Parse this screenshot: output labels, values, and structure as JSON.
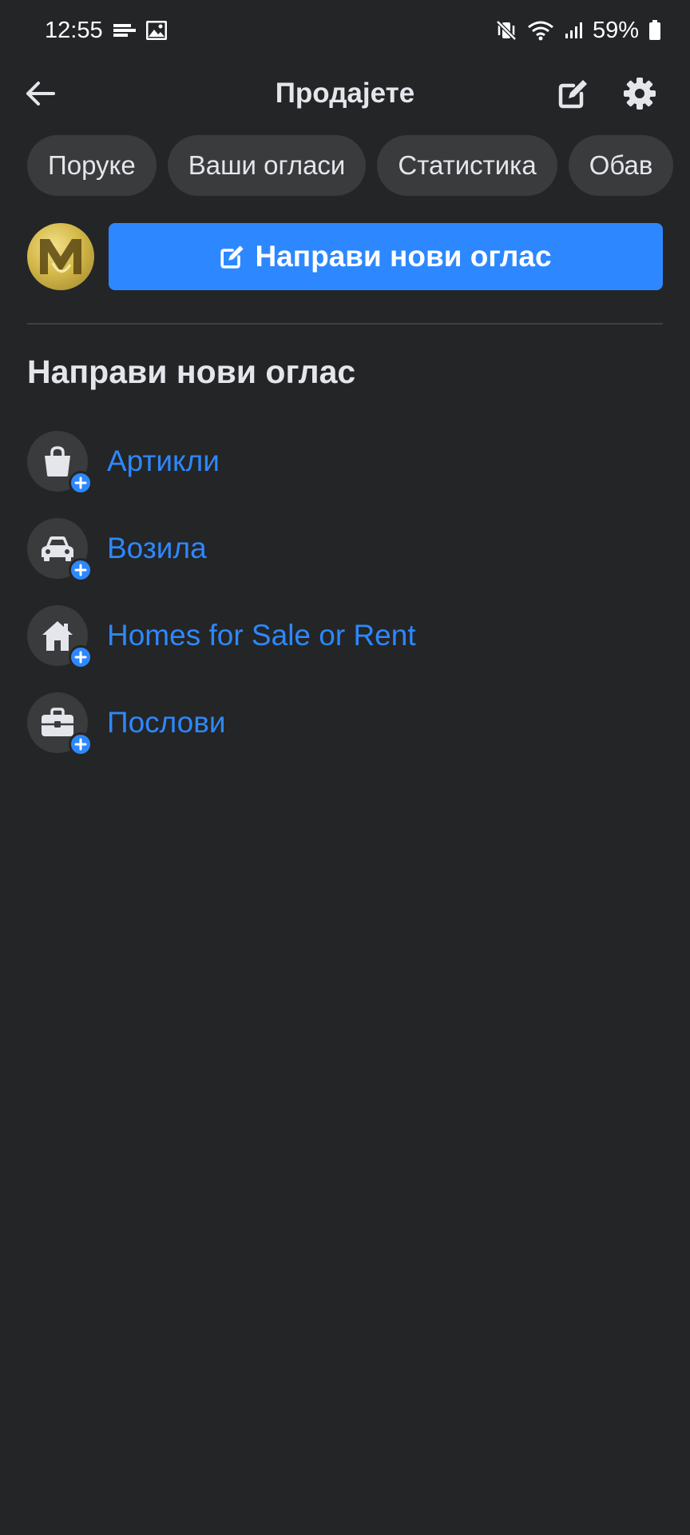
{
  "status_bar": {
    "time": "12:55",
    "battery": "59%"
  },
  "header": {
    "title": "Продајете"
  },
  "tabs": [
    {
      "label": "Поруке"
    },
    {
      "label": "Ваши огласи"
    },
    {
      "label": "Статистика"
    },
    {
      "label": "Обав"
    }
  ],
  "create_button": {
    "label": "Направи нови оглас"
  },
  "section": {
    "title": "Направи нови оглас",
    "items": [
      {
        "label": "Артикли",
        "icon": "shopping-bag-icon"
      },
      {
        "label": "Возила",
        "icon": "car-icon"
      },
      {
        "label": "Homes for Sale or Rent",
        "icon": "house-icon"
      },
      {
        "label": "Послови",
        "icon": "briefcase-icon"
      }
    ]
  },
  "colors": {
    "background": "#242526",
    "accent": "#2d88ff",
    "chip": "#3a3b3c",
    "text": "#e4e6eb"
  }
}
